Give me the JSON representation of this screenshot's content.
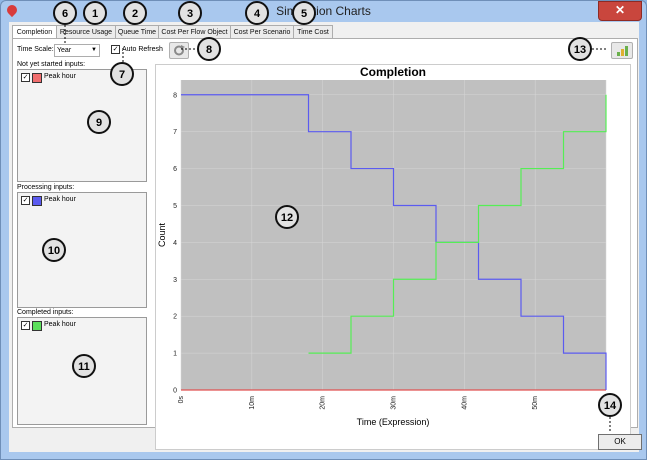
{
  "window": {
    "title": "Simulation Charts",
    "close_glyph": "✕"
  },
  "tabs": [
    "Completion",
    "Resource Usage",
    "Queue Time",
    "Cost Per Flow Object",
    "Cost Per Scenario",
    "Time Cost"
  ],
  "controls": {
    "time_scale_label": "Time Scale:",
    "time_scale_value": "Year",
    "auto_refresh_label": "Auto Refresh",
    "auto_refresh_checked": true
  },
  "panels": {
    "not_started": {
      "title": "Not yet started inputs:",
      "item": "Peak hour",
      "color": "#f06d6d"
    },
    "processing": {
      "title": "Processing inputs:",
      "item": "Peak hour",
      "color": "#5b5bf0"
    },
    "completed": {
      "title": "Completed inputs:",
      "item": "Peak hour",
      "color": "#5ce05c"
    }
  },
  "markers": [
    "6",
    "1",
    "2",
    "3",
    "4",
    "5",
    "7",
    "8",
    "9",
    "10",
    "11",
    "12",
    "13",
    "14"
  ],
  "chart_data": {
    "type": "line",
    "title": "Completion",
    "xlabel": "Time (Expression)",
    "ylabel": "Count",
    "x_ticks": [
      "0s",
      "10m",
      "20m",
      "30m",
      "40m",
      "50m",
      "1h"
    ],
    "y_ticks": [
      "0",
      "1",
      "2",
      "3",
      "4",
      "5",
      "6",
      "7",
      "8"
    ],
    "xlim": [
      0,
      60
    ],
    "ylim": [
      0,
      8.4
    ],
    "series": [
      {
        "name": "Not yet started",
        "color": "#e05050",
        "step": true,
        "x": [
          0,
          60
        ],
        "y": [
          0,
          0
        ]
      },
      {
        "name": "Processing",
        "color": "#5b5bf0",
        "step": true,
        "x": [
          0,
          18,
          24,
          30,
          36,
          42,
          48,
          54,
          60
        ],
        "y": [
          8,
          7,
          6,
          5,
          4,
          3,
          2,
          1,
          0
        ]
      },
      {
        "name": "Completed",
        "color": "#55ee55",
        "step": true,
        "x": [
          18,
          24,
          30,
          36,
          42,
          48,
          54,
          60
        ],
        "y": [
          1,
          2,
          3,
          4,
          5,
          6,
          7,
          8
        ]
      }
    ]
  },
  "footer": {
    "ok_label": "OK"
  },
  "icons": {
    "refresh": "refresh-icon",
    "export": "chart-export-icon"
  }
}
